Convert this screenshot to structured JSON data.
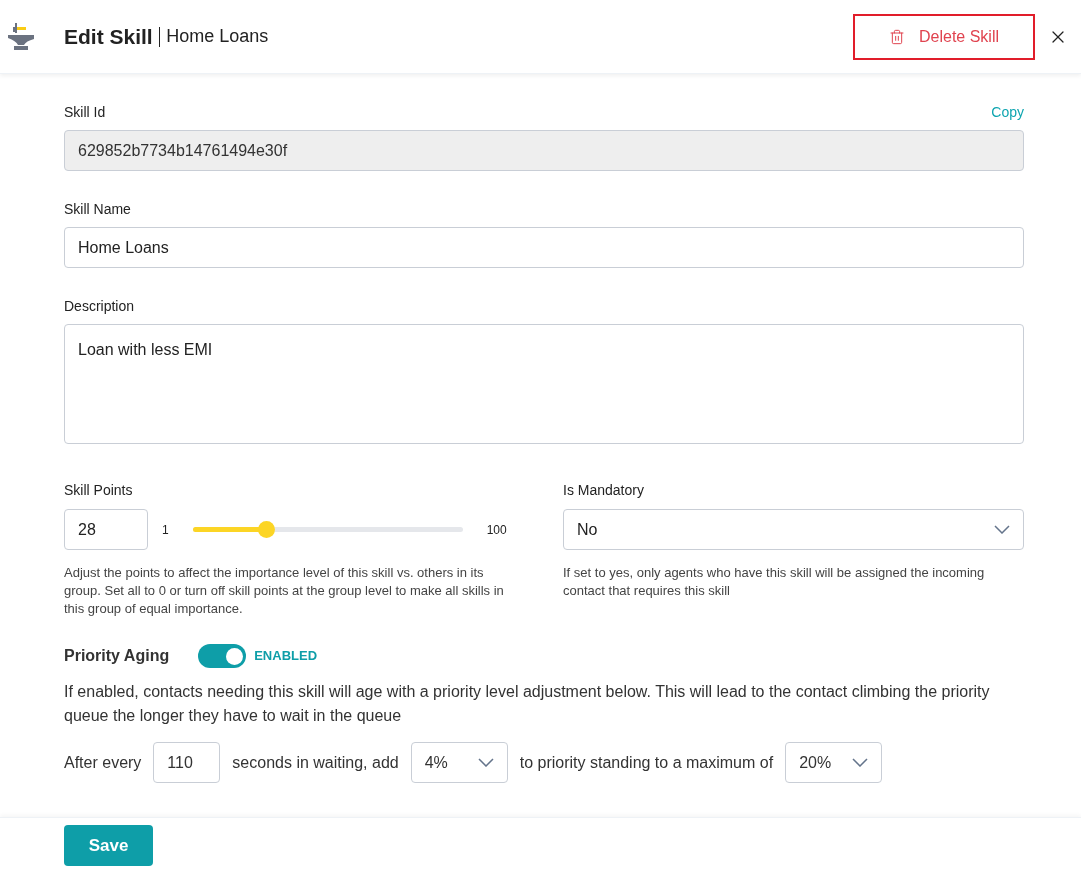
{
  "header": {
    "title": "Edit Skill",
    "subtitle": "Home Loans",
    "delete_button": "Delete Skill"
  },
  "skill_id": {
    "label": "Skill Id",
    "copy_link": "Copy",
    "value": "629852b7734b14761494e30f"
  },
  "skill_name": {
    "label": "Skill Name",
    "value": "Home Loans"
  },
  "description": {
    "label": "Description",
    "value": "Loan with less EMI"
  },
  "skill_points": {
    "label": "Skill Points",
    "value": "28",
    "min": "1",
    "max": "100",
    "level": 0.27,
    "help": "Adjust the points to affect the importance level of this skill vs. others in its group. Set all to 0 or turn off skill points at the group level to make all skills in this group of equal importance."
  },
  "is_mandatory": {
    "label": "Is Mandatory",
    "value": "No",
    "help": "If set to yes, only agents who have this skill will be assigned the incoming contact that requires this skill"
  },
  "priority_aging": {
    "label": "Priority Aging",
    "on": true,
    "status": "ENABLED",
    "help": "If enabled, contacts needing this skill will age with a priority level adjustment below. This will lead to the contact climbing the priority queue the longer they have to wait in the queue",
    "rule": [
      {
        "kind": "text",
        "text": "After every"
      },
      {
        "kind": "input",
        "value": "110"
      },
      {
        "kind": "text",
        "text": "seconds in waiting, add"
      },
      {
        "kind": "select",
        "value": "4%"
      },
      {
        "kind": "text",
        "text": "to priority standing to a maximum of"
      },
      {
        "kind": "select",
        "value": "20%"
      }
    ]
  },
  "footer": {
    "save_button": "Save"
  }
}
